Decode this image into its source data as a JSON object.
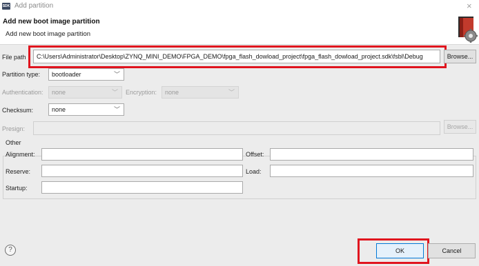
{
  "window": {
    "app_icon_text": "SDK",
    "title": "Add partition",
    "close_glyph": "×"
  },
  "header": {
    "title": "Add new boot image partition",
    "subtitle": "Add new boot image partition",
    "icon": "boot-image-gear-icon"
  },
  "file_path": {
    "label": "File path",
    "value": "C:\\Users\\Administrator\\Desktop\\ZYNQ_MINI_DEMO\\FPGA_DEMO\\fpga_flash_dowload_project\\fpga_flash_dowload_project.sdk\\fsbl\\Debug",
    "browse_label": "Browse..."
  },
  "partition_type": {
    "label": "Partition type:",
    "value": "bootloader"
  },
  "authentication": {
    "label": "Authentication:",
    "value": "none"
  },
  "encryption": {
    "label": "Encryption:",
    "value": "none"
  },
  "checksum": {
    "label": "Checksum:",
    "value": "none"
  },
  "presign": {
    "label": "Presign:",
    "value": "",
    "browse_label": "Browse..."
  },
  "other": {
    "group_label": "Other",
    "alignment_label": "Alignment:",
    "alignment_value": "",
    "offset_label": "Offset:",
    "offset_value": "",
    "reserve_label": "Reserve:",
    "reserve_value": "",
    "load_label": "Load:",
    "load_value": "",
    "startup_label": "Startup:",
    "startup_value": ""
  },
  "footer": {
    "help_glyph": "?",
    "ok_label": "OK",
    "cancel_label": "Cancel"
  },
  "colors": {
    "highlight_red": "#e0141e",
    "ok_border": "#0078d7"
  }
}
